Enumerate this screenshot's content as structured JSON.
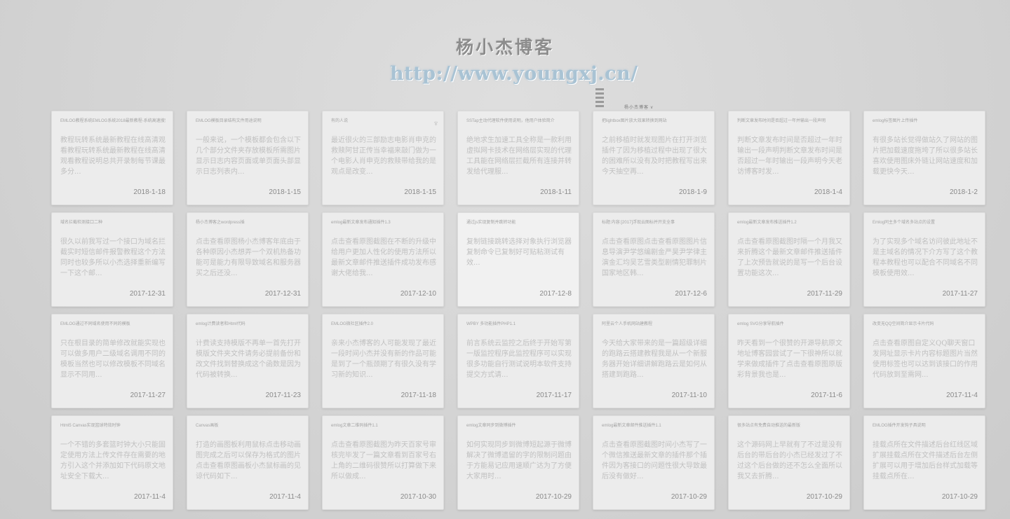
{
  "header": {
    "title": "杨小杰博客",
    "url": "http://www.youngxj.cn/",
    "deco_label": "杨小杰博客 v"
  },
  "posts": [
    {
      "title": "EMLOG教程系统EMLOG系统2018最新教程-系统高速搜索",
      "excerpt": "教程玩转系统最新教程在线高清观看教程玩转系统最新教程在线高清观看教程说明总共开录制每节课最多分...",
      "date": "2018-1-18"
    },
    {
      "title": "EMLOG模板目录结构文件用途说明",
      "excerpt": "一般来说，一个模板都会包含以下几个部分文件夹存放模板所需图片显示日志内容页面或单页面头部显示日志列表内...",
      "date": "2018-1-15"
    },
    {
      "title": "有的人说",
      "excerpt": "最近很火的三部励志电影肖申克的救赎阿甘正传当幸福来敲门做为一个电影人肖申克的救赎带给我的是观点是改变...",
      "date": "2018-1-15",
      "icon": "♆"
    },
    {
      "title": "SSTap主动代理软件使用说明，他用户体验简介",
      "excerpt": "绝地求生加速工具全称是一款利用虚拟网卡技术在网络层实现的代理工具能在网络层拦截所有连接并转发给代理服...",
      "date": "2018-1-11"
    },
    {
      "title": "把lightbox图片放大效果转换到网站",
      "excerpt": "之前移植时就发现图片在打开浏览插件了因为移植过程中出现了很大的困难所以没有及时把教程写出来今天抽空再...",
      "date": "2018-1-9"
    },
    {
      "title": "判断文章发布时间是否超过一年并输出一段声明",
      "excerpt": "判断文章发布时间是否超过一年时输出一段声明判断文章发布时间是否超过一年时输出一段声明今天老访博客时发...",
      "date": "2018-1-4"
    },
    {
      "title": "emlog标签图片上传插件",
      "excerpt": "有很多站长觉得做站久了网站的图片把加载速度拖垮了所以很多站长喜欢使用图床外链让网站速度和加载更快今天...",
      "date": "2018-1-2"
    },
    {
      "title": "域名拦截检测接口二种",
      "excerpt": "很久以前我写过一个接口为域名拦截实时短信邮件报警教程这个方法同时也较多所以小杰选择重新编写一下这个邮...",
      "date": "2017-12-31"
    },
    {
      "title": "杨小杰博客之wordpress插",
      "excerpt": "点击查看原图杨小杰博客年底由于各种原因小杰想弄一个双机热备功能可是能力有限导致域名和服务器买之后还没...",
      "date": "2017-12-31"
    },
    {
      "title": "emlog最新文章发布通知插件1.3",
      "excerpt": "点击查看原图截图在不断的升级中给用户更加人性化的使用方法所以最新文章邮件推送插件成功发布感谢大佬给我...",
      "date": "2017-12-10"
    },
    {
      "title": "通过js实现复制并跳转功能",
      "excerpt": "复制链接跳转选择对象执行浏览器复制命令已复制好可贴粘测试有效...",
      "date": "2017-12-8",
      "active": true
    },
    {
      "title": "标题:内容:[2017]浮现云图标并开支全事",
      "excerpt": "点击查看原图点击查看原图图片信息导演尹学悠编剧金严昊尹学律主演金汇均吴艺雪类型剧情犯罪制片国家地区韩...",
      "date": "2017-12-6"
    },
    {
      "title": "emlog最新文章发布推送插件1.2",
      "excerpt": "点击查看原图截图时隔一个月我又来折腾这个最新文章邮件推送插件了上次预告就说的是写一个后台设置功能这次...",
      "date": "2017-11-29"
    },
    {
      "title": "Emlog同主多个域名多站点的设置",
      "excerpt": "为了实现多个域名访问彼此地址不是主域名的情况下介方写了这个教程本教程也可以配合不同域名不同模板使用效...",
      "date": "2017-11-27"
    },
    {
      "title": "EMLOG通过不同域名使用不同的模板",
      "excerpt": "只在根目录的简单修改就能实现也可以做多用户二级域名调用不同的模板当然也可以修改模板不同域名显示不同用...",
      "date": "2017-11-27"
    },
    {
      "title": "emlog计费读者和Html代码",
      "excerpt": "计费读支持模版不再单一首先打开模版文件夹文件请务必提前备份和改文件找到替换成这个函数是因为代码被转换...",
      "date": "2017-11-23"
    },
    {
      "title": "EMLOG微社区插件2.0",
      "excerpt": "亲来小杰博客的人可能发现了最近一段时间小杰并没有新的作品可能是到了一个瓶颈期了有很久没有学习新的知识...",
      "date": "2017-11-18"
    },
    {
      "title": "WPBY 多功能插件PHP1.1",
      "excerpt": "前言系统云监控之后终于开始写第一版监控程序此监控程序可以实现很多功能自行测试说明本软件支持提交方式请...",
      "date": "2017-11-17"
    },
    {
      "title": "阿里云个人手机网站建教程",
      "excerpt": "今天给大家带来的是一篇超级详细的跑路云搭建教程我是从一个新服务器开始详细讲解跑路云是如何从搭建到跑路...",
      "date": "2017-11-10"
    },
    {
      "title": "emlog SVG分享导航插件",
      "excerpt": "昨天看到一个很赞的开源导航原文地址博客园尝试了一下很神所以就学来做成插件了点击查看原图原版彩背景我也是...",
      "date": "2017-11-6"
    },
    {
      "title": "改变无QQ空间简介显示卡片代码",
      "excerpt": "点击查看原图自定义QQ聊天窗口发网址显示卡片内容标题图片当然使用标签也可以达到该接口的作用代码放到至需网...",
      "date": "2017-11-4"
    },
    {
      "title": "Html5 Canvas实现篮球特效时钟",
      "excerpt": "一个不错的多套篮时钟大小只能固定使用方法上传文件存在需要的地方引入这个并添加如下代码原文地址安全下载大...",
      "date": "2017-11-4"
    },
    {
      "title": "Canvas画板",
      "excerpt": "打造的画图板利用鼠标点击移动画图完成之后可以保存为格式的图片点击查看原图画板小杰鼠标画的见谅代码如下...",
      "date": "2017-11-4"
    },
    {
      "title": "emlog文章二维码插件1.1",
      "excerpt": "点击查看原图截图为昨天百家号审核完毕发了一篇文章看到百家号右上角的二维码很赞所以打算做下来所以做成...",
      "date": "2017-10-30"
    },
    {
      "title": "emlog文章同步到微博插件",
      "excerpt": "如何实现同步到微博短起源于微博解决了微博遗留的字的限制问题由于方能易记应用速顺广达为了方便大家用时...",
      "date": "2017-10-29"
    },
    {
      "title": "emlog最新文章邮件推送插件1.1",
      "excerpt": "点击查看原图截图时间小杰写了一个微信推送最新文章的插件那个插件因为客接口的问题性很大导致最后没有做好...",
      "date": "2017-10-29"
    },
    {
      "title": "很多站点有免费自动推送的最新版",
      "excerpt": "这个源码网上早就有了不过是没有后台的带后台的小杰已经发过了不过这个后台做的还不怎么全面所以我又去折腾...",
      "date": "2017-10-29"
    },
    {
      "title": "EMLOG插件开发钩子具说明",
      "excerpt": "挂载点所在文件描述后台红线区域扩展挂载点所在文件描述后台左侧扩展可以用于增加后台样式加载等挂载点所在...",
      "date": "2017-10-29"
    }
  ]
}
